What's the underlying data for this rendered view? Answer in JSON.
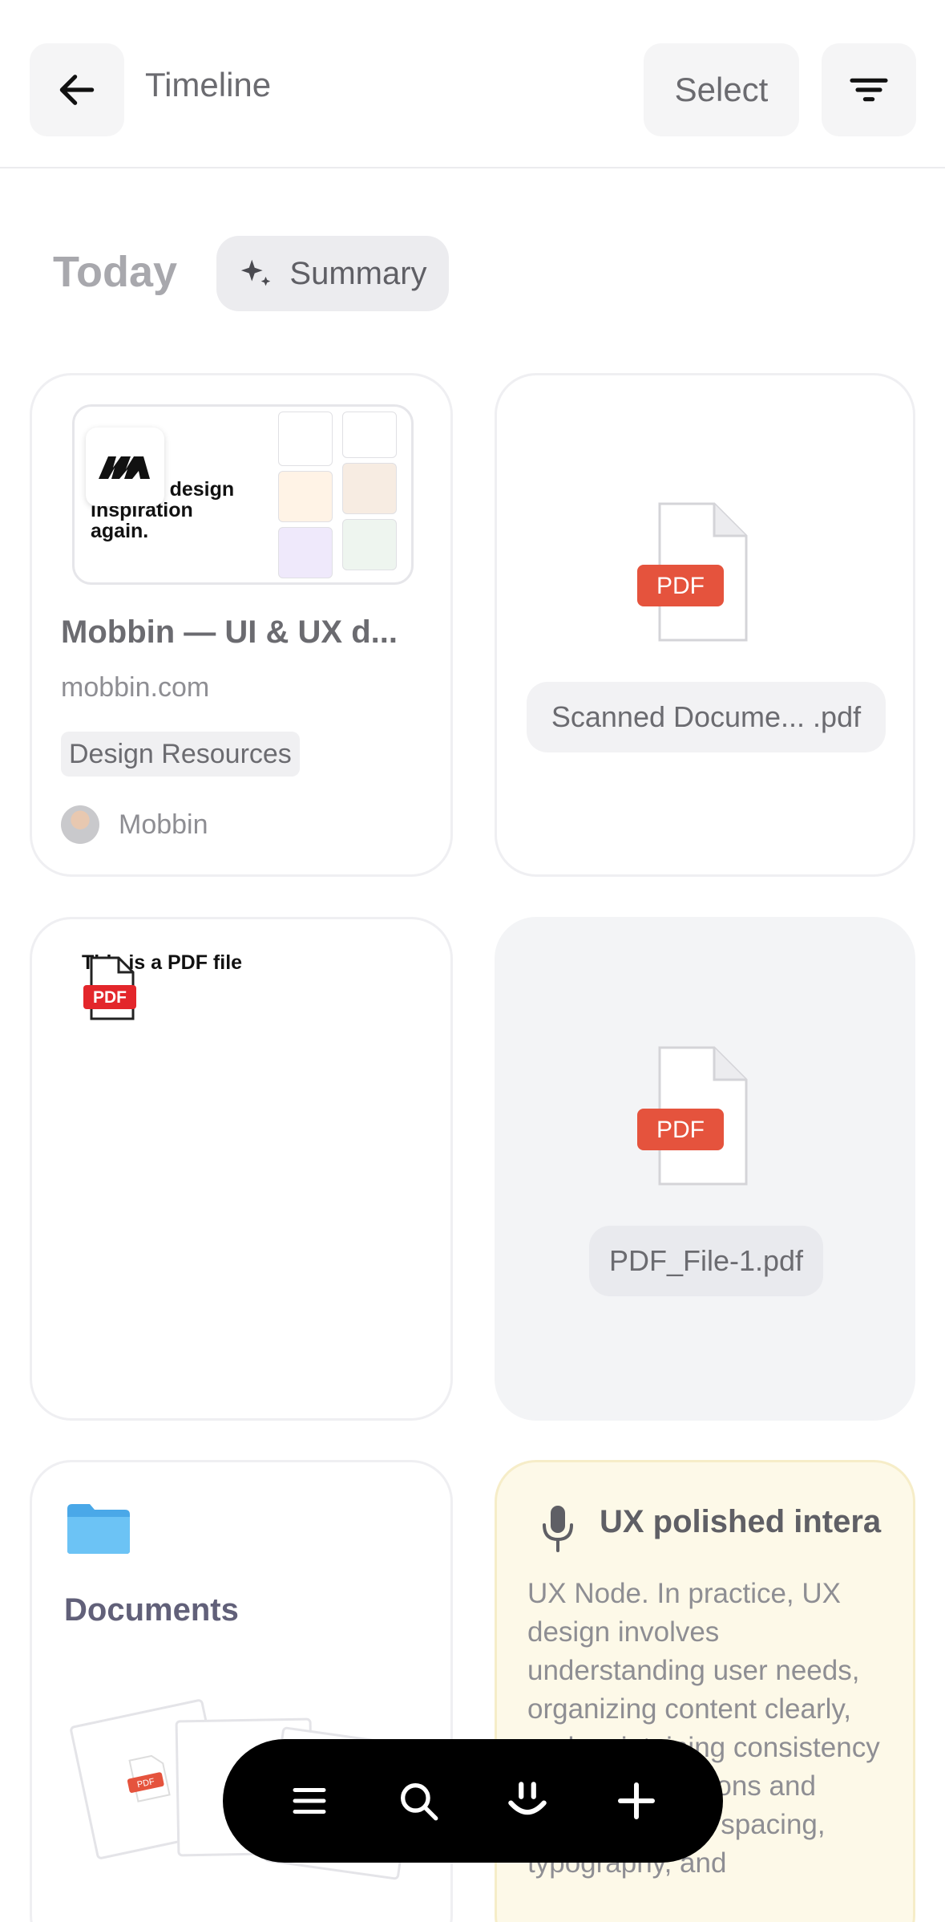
{
  "header": {
    "title": "Timeline",
    "select_label": "Select",
    "back_icon": "arrow-left-icon",
    "filter_icon": "filter-lines-icon"
  },
  "section": {
    "heading": "Today",
    "summary_label": "Summary",
    "summary_icon": "sparkle-icon"
  },
  "cards": {
    "bookmark": {
      "thumbnail_text": "n out of design inspiration again.",
      "title": "Mobbin — UI & UX d...",
      "domain": "mobbin.com",
      "tag": "Design Resources",
      "author": "Mobbin"
    },
    "pdf_scanned": {
      "badge": "PDF",
      "filename": "Scanned Docume... .pdf"
    },
    "pdf_preview": {
      "doc_text": "This is a PDF file",
      "badge": "PDF"
    },
    "pdf_file": {
      "badge": "PDF",
      "filename": "PDF_File-1.pdf"
    },
    "folder": {
      "title": "Documents",
      "badge": "PDF"
    },
    "voice_note": {
      "title": "UX polished intera",
      "body": "UX Node. In practice, UX design involves understanding user needs, organizing content clearly, and maintaining consistency across interactions and details such as spacing, typography, and"
    }
  },
  "toolbar": {
    "items": [
      "menu-icon",
      "search-icon",
      "smile-icon",
      "plus-icon"
    ]
  },
  "colors": {
    "pdf_red": "#e5533d",
    "voice_card_bg": "#fdf9e8",
    "folder_blue": "#5cb8f2"
  }
}
